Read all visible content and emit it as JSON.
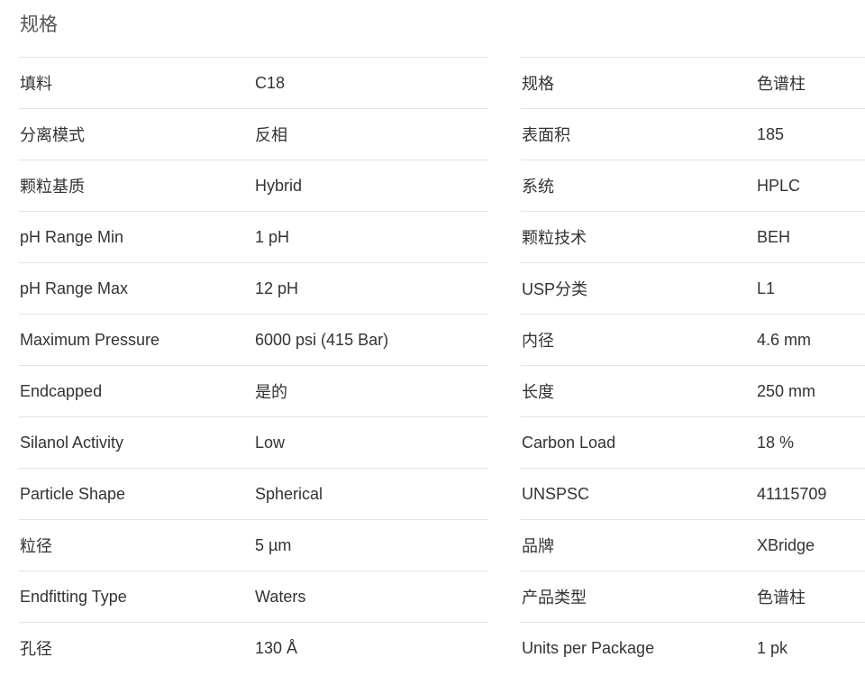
{
  "title": "规格",
  "left": [
    {
      "label": "填料",
      "value": "C18"
    },
    {
      "label": "分离模式",
      "value": "反相"
    },
    {
      "label": "颗粒基质",
      "value": "Hybrid"
    },
    {
      "label": "pH Range Min",
      "value": "1 pH"
    },
    {
      "label": "pH Range Max",
      "value": "12 pH"
    },
    {
      "label": "Maximum Pressure",
      "value": "6000 psi (415 Bar)"
    },
    {
      "label": "Endcapped",
      "value": "是的"
    },
    {
      "label": "Silanol Activity",
      "value": "Low"
    },
    {
      "label": "Particle Shape",
      "value": "Spherical"
    },
    {
      "label": "粒径",
      "value": "5 µm"
    },
    {
      "label": "Endfitting Type",
      "value": "Waters"
    },
    {
      "label": "孔径",
      "value": "130 Å"
    }
  ],
  "right": [
    {
      "label": "规格",
      "value": "色谱柱"
    },
    {
      "label": "表面积",
      "value": "185"
    },
    {
      "label": "系统",
      "value": "HPLC"
    },
    {
      "label": "颗粒技术",
      "value": "BEH"
    },
    {
      "label": "USP分类",
      "value": "L1"
    },
    {
      "label": "内径",
      "value": "4.6 mm"
    },
    {
      "label": "长度",
      "value": "250 mm"
    },
    {
      "label": "Carbon Load",
      "value": "18 %"
    },
    {
      "label": "UNSPSC",
      "value": "41115709"
    },
    {
      "label": "品牌",
      "value": "XBridge"
    },
    {
      "label": "产品类型",
      "value": "色谱柱"
    },
    {
      "label": "Units per Package",
      "value": "1 pk"
    }
  ]
}
